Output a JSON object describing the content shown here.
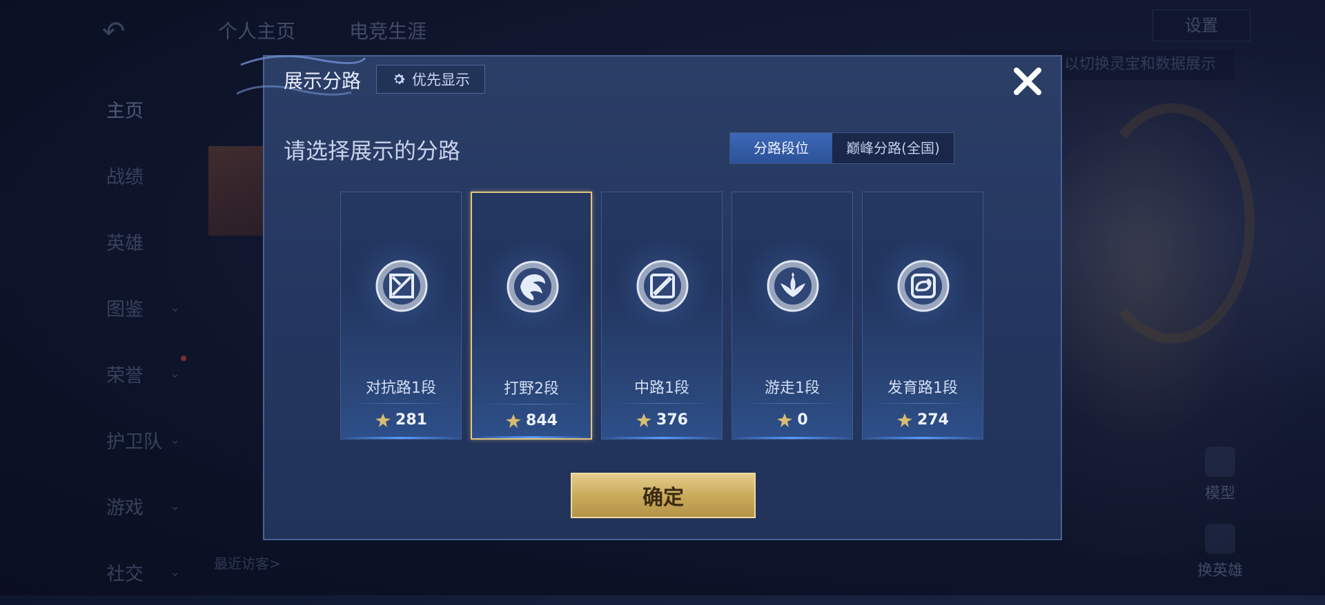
{
  "background": {
    "tabs": [
      "个人主页",
      "电竞生涯"
    ],
    "menu": [
      {
        "label": "主页",
        "chevron": false,
        "dot": false,
        "active": true
      },
      {
        "label": "战绩",
        "chevron": false,
        "dot": false
      },
      {
        "label": "英雄",
        "chevron": false,
        "dot": false
      },
      {
        "label": "图鉴",
        "chevron": true,
        "dot": false
      },
      {
        "label": "荣誉",
        "chevron": true,
        "dot": true
      },
      {
        "label": "护卫队",
        "chevron": true,
        "dot": false
      },
      {
        "label": "游戏",
        "chevron": true,
        "dot": false
      },
      {
        "label": "社交",
        "chevron": true,
        "dot": false
      }
    ],
    "settings_label": "设置",
    "hint_text": "以切换灵宝和数据展示",
    "model_label": "模型",
    "switch_hero_label": "换英雄",
    "recent_visitors_label": "最近访客>"
  },
  "dialog": {
    "title": "展示分路",
    "priority_button": "优先显示",
    "subtitle": "请选择展示的分路",
    "segments": {
      "active": "分路段位",
      "inactive": "巅峰分路(全国)"
    },
    "lanes": [
      {
        "name": "对抗路1段",
        "score": "281",
        "icon": "clash-lane-icon",
        "selected": false
      },
      {
        "name": "打野2段",
        "score": "844",
        "icon": "jungle-icon",
        "selected": true
      },
      {
        "name": "中路1段",
        "score": "376",
        "icon": "mid-lane-icon",
        "selected": false
      },
      {
        "name": "游走1段",
        "score": "0",
        "icon": "roam-icon",
        "selected": false
      },
      {
        "name": "发育路1段",
        "score": "274",
        "icon": "farm-lane-icon",
        "selected": false
      }
    ],
    "confirm_label": "确定"
  },
  "colors": {
    "dialog_bg": "#253760",
    "accent_blue": "#3d68b6",
    "gold": "#d8bc6f",
    "selected_border": "#e3c67c"
  }
}
